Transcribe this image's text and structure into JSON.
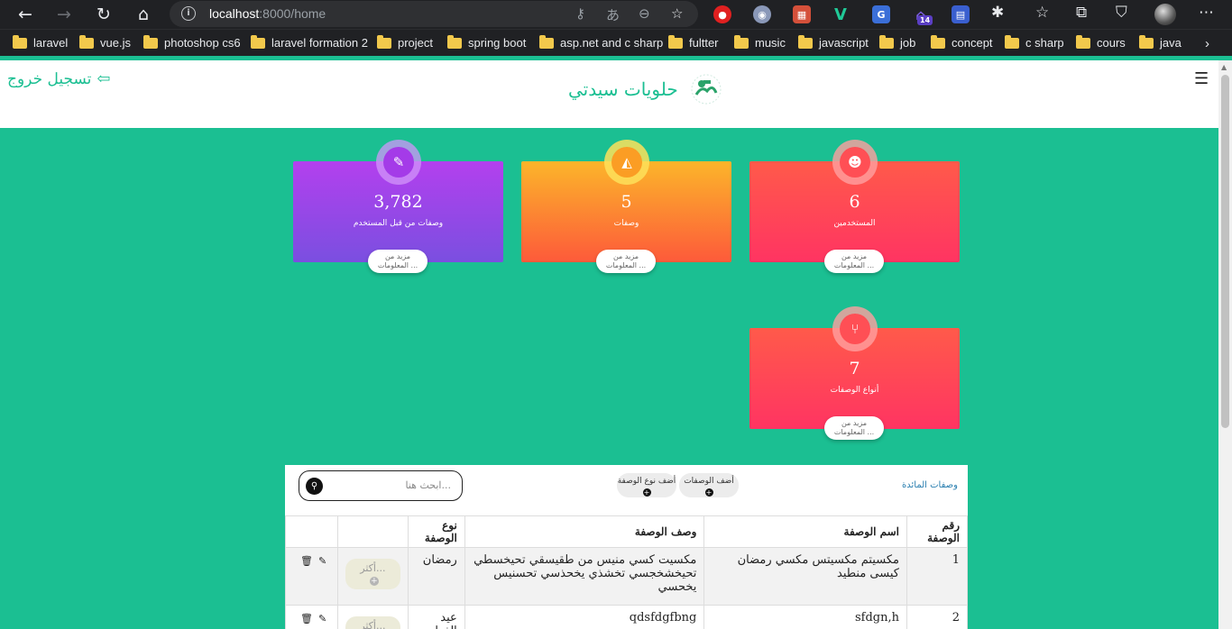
{
  "browser": {
    "url_host": "localhost",
    "url_port_path": ":8000/home",
    "bookmarks": [
      "laravel",
      "vue.js",
      "photoshop cs6",
      "laravel formation 2",
      "project",
      "spring boot",
      "asp.net and c sharp",
      "fultter",
      "music",
      "javascript",
      "job",
      "concept",
      "c sharp",
      "cours",
      "java"
    ],
    "extension_badge": "14"
  },
  "header": {
    "logout_label": "تسجيل خروج",
    "brand_name": "حلويات سيدتي"
  },
  "cards": {
    "user_recipes": {
      "value": "3,782",
      "label": "وصفات من قبل المستخدم",
      "more": "مزيد من المعلومات ..."
    },
    "recipes": {
      "value": "5",
      "label": "وصفات",
      "more": "مزيد من المعلومات ..."
    },
    "users": {
      "value": "6",
      "label": "المستخدمين",
      "more": "مزيد من المعلومات ..."
    },
    "recipe_types": {
      "value": "7",
      "label": "أنواع الوصفات",
      "more": "مزيد من المعلومات ..."
    }
  },
  "table_panel": {
    "title": "وصفات المائدة",
    "add_recipe": "أضف الوصفات",
    "add_recipe_type": "أضف نوع الوصفة",
    "search_placeholder": "ابحث هنا..."
  },
  "table": {
    "headers": {
      "id": "رقم الوصفة",
      "name": "اسم الوصفة",
      "description": "وصف الوصفة",
      "type": "نوع الوصفة"
    },
    "more_label": "أكثر...",
    "rows": [
      {
        "id": "1",
        "name": "مكسيتم مكسيتس مكسي رمضان كيسى منطيد",
        "description": "مكسيت كسي منيس من طقيسقي تحيخسطي تحيخشخجسي تخشذي يخحذسي تحسنيس يخحسي",
        "type": "رمضان"
      },
      {
        "id": "2",
        "name": "sfdgn,h",
        "description": "qdsfdgfbng",
        "type": "عيد الفطر"
      }
    ]
  }
}
